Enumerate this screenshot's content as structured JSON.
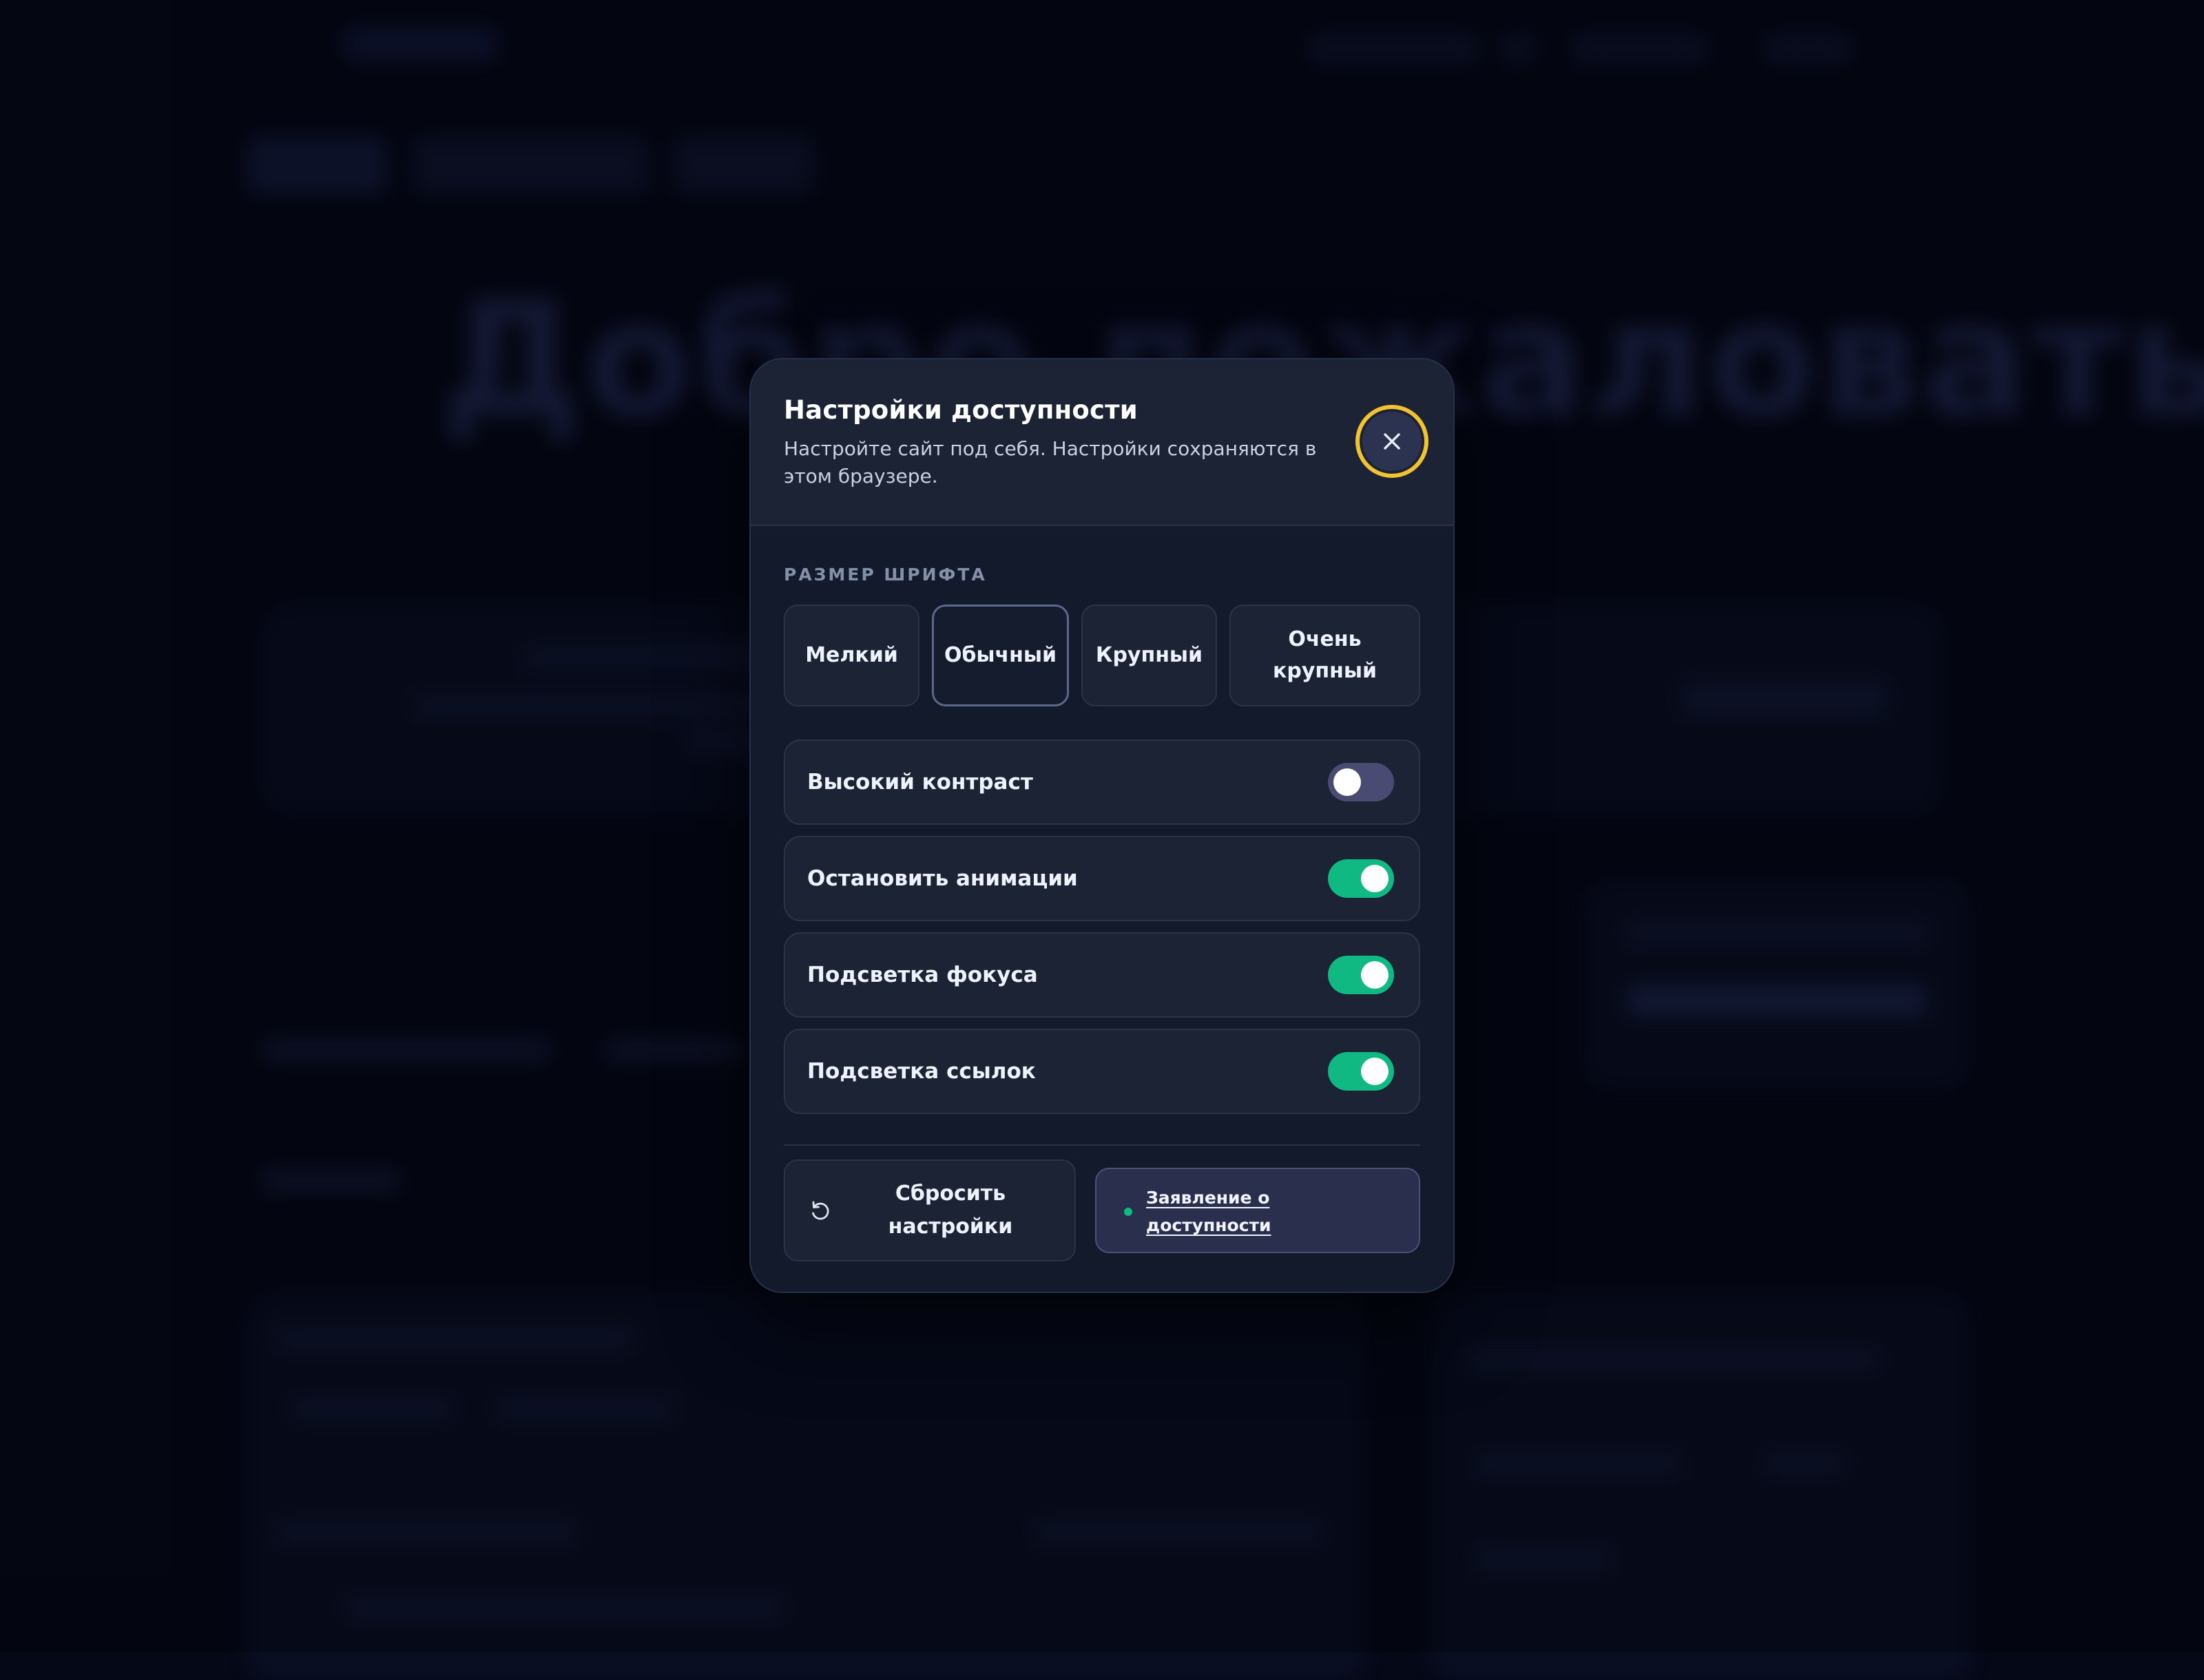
{
  "background": {
    "hero_text": "Добро пожаловать!"
  },
  "dialog": {
    "title": "Настройки доступности",
    "subtitle": "Настройте сайт под себя. Настройки сохраняются в этом браузере.",
    "close_icon": "close-icon",
    "font_size": {
      "label": "РАЗМЕР ШРИФТА",
      "options": [
        {
          "label": "Мелкий",
          "selected": false
        },
        {
          "label": "Обычный",
          "selected": true
        },
        {
          "label": "Крупный",
          "selected": false
        },
        {
          "label": "Очень крупный",
          "selected": false
        }
      ]
    },
    "toggles": [
      {
        "label": "Высокий контраст",
        "on": false
      },
      {
        "label": "Остановить анимации",
        "on": true
      },
      {
        "label": "Подсветка фокуса",
        "on": true
      },
      {
        "label": "Подсветка ссылок",
        "on": true
      }
    ],
    "reset_label": "Сбросить настройки",
    "reset_icon": "reset-icon",
    "statement_label": "Заявление о доступности"
  },
  "colors": {
    "accent_focus": "#f1c232",
    "toggle_on": "#10b981",
    "toggle_off": "#4a4b72",
    "dialog_bg": "#121a2b"
  }
}
